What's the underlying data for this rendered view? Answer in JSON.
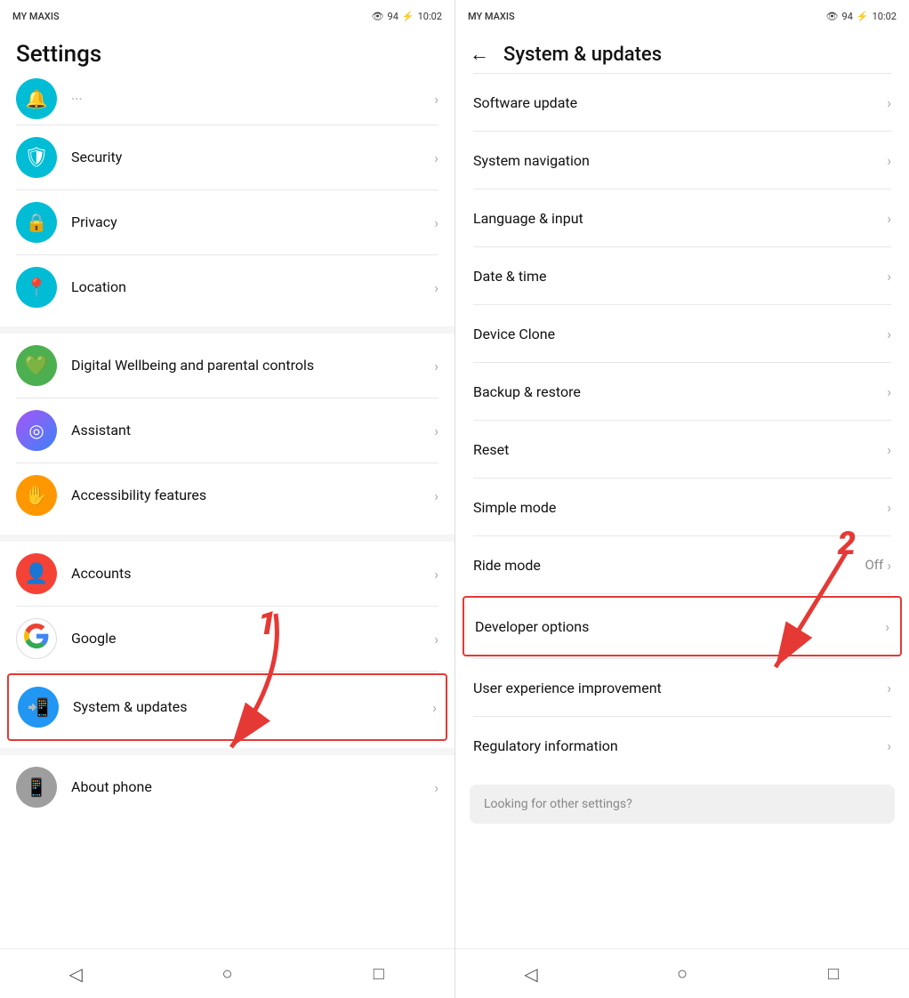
{
  "left_panel": {
    "status": {
      "carrier": "MY MAXIS",
      "battery": "94",
      "time": "10:02"
    },
    "title": "Settings",
    "partial_item": {
      "label": "..."
    },
    "items": [
      {
        "id": "security",
        "icon": "🛡️",
        "icon_bg": "icon-teal",
        "label": "Security",
        "chevron": "›"
      },
      {
        "id": "privacy",
        "icon": "🔒",
        "icon_bg": "icon-teal",
        "label": "Privacy",
        "chevron": "›"
      },
      {
        "id": "location",
        "icon": "📍",
        "icon_bg": "icon-teal",
        "label": "Location",
        "chevron": "›"
      }
    ],
    "section2": [
      {
        "id": "digital-wellbeing",
        "icon": "💚",
        "icon_bg": "icon-green",
        "label": "Digital Wellbeing and parental controls",
        "chevron": "›"
      },
      {
        "id": "assistant",
        "icon": "◎",
        "icon_bg": "icon-gradient",
        "label": "Assistant",
        "chevron": "›"
      },
      {
        "id": "accessibility",
        "icon": "✋",
        "icon_bg": "icon-orange",
        "label": "Accessibility features",
        "chevron": "›"
      }
    ],
    "section3": [
      {
        "id": "accounts",
        "icon": "👤",
        "icon_bg": "icon-red",
        "label": "Accounts",
        "chevron": "›"
      },
      {
        "id": "google",
        "icon": "G",
        "icon_bg": "icon-blue",
        "label": "Google",
        "chevron": "›"
      },
      {
        "id": "system-updates",
        "icon": "📱",
        "icon_bg": "icon-blue",
        "label": "System & updates",
        "chevron": "›",
        "highlighted": true
      }
    ],
    "section4": [
      {
        "id": "about-phone",
        "icon": "📱",
        "icon_bg": "icon-gray",
        "label": "About phone",
        "chevron": "›"
      }
    ],
    "annotation": {
      "number": "1"
    },
    "nav": {
      "back": "◁",
      "home": "○",
      "recents": "□"
    }
  },
  "right_panel": {
    "status": {
      "carrier": "MY MAXIS",
      "battery": "94",
      "time": "10:02"
    },
    "header": {
      "back_icon": "←",
      "title": "System & updates"
    },
    "items": [
      {
        "id": "software-update",
        "label": "Software update",
        "value": "",
        "chevron": "›"
      },
      {
        "id": "system-navigation",
        "label": "System navigation",
        "value": "",
        "chevron": "›"
      },
      {
        "id": "language-input",
        "label": "Language & input",
        "value": "",
        "chevron": "›"
      },
      {
        "id": "date-time",
        "label": "Date & time",
        "value": "",
        "chevron": "›"
      },
      {
        "id": "device-clone",
        "label": "Device Clone",
        "value": "",
        "chevron": "›"
      },
      {
        "id": "backup-restore",
        "label": "Backup & restore",
        "value": "",
        "chevron": "›"
      },
      {
        "id": "reset",
        "label": "Reset",
        "value": "",
        "chevron": "›"
      },
      {
        "id": "simple-mode",
        "label": "Simple mode",
        "value": "",
        "chevron": "›"
      },
      {
        "id": "ride-mode",
        "label": "Ride mode",
        "value": "Off",
        "chevron": "›"
      },
      {
        "id": "developer-options",
        "label": "Developer options",
        "value": "",
        "chevron": "›",
        "highlighted": true
      },
      {
        "id": "user-experience",
        "label": "User experience improvement",
        "value": "",
        "chevron": "›"
      },
      {
        "id": "regulatory",
        "label": "Regulatory information",
        "value": "",
        "chevron": "›"
      }
    ],
    "search_hint": "Looking for other settings?",
    "annotation": {
      "number": "2"
    },
    "nav": {
      "back": "◁",
      "home": "○",
      "recents": "□"
    }
  }
}
